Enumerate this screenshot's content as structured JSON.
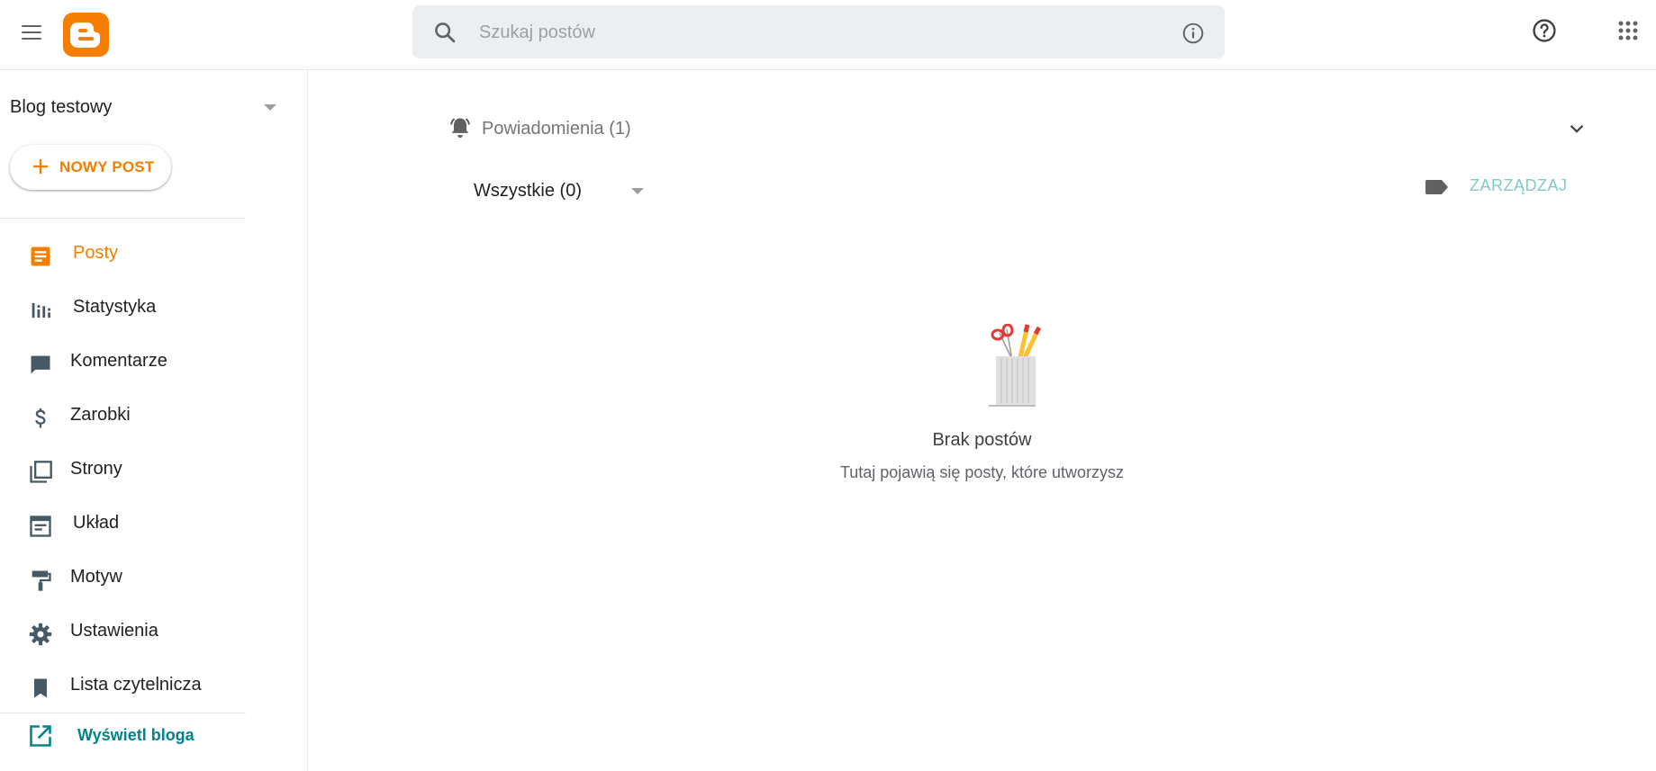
{
  "header": {
    "search_placeholder": "Szukaj postów",
    "icons": [
      "menu-icon",
      "blogger-logo",
      "search-icon",
      "info-icon",
      "help-icon",
      "apps-grid-icon"
    ],
    "brand_color": "#f57d00"
  },
  "sidebar": {
    "blog_name": "Blog testowy",
    "new_post_label": "NOWY POST",
    "items": [
      {
        "label": "Posty",
        "icon": "posts-icon",
        "active": true
      },
      {
        "label": "Statystyka",
        "icon": "stats-icon",
        "active": false
      },
      {
        "label": "Komentarze",
        "icon": "comments-icon",
        "active": false
      },
      {
        "label": "Zarobki",
        "icon": "dollar-icon",
        "active": false
      },
      {
        "label": "Strony",
        "icon": "pages-icon",
        "active": false
      },
      {
        "label": "Układ",
        "icon": "layout-icon",
        "active": false
      },
      {
        "label": "Motyw",
        "icon": "paint-roller-icon",
        "active": false
      },
      {
        "label": "Ustawienia",
        "icon": "gear-icon",
        "active": false
      },
      {
        "label": "Lista czytelnicza",
        "icon": "bookmark-icon",
        "active": false
      }
    ],
    "view_blog_label": "Wyświetl bloga",
    "accent_color": "#00838f"
  },
  "main": {
    "notifications_label": "Powiadomienia (1)",
    "filter_label": "Wszystkie (0)",
    "manage_label": "ZARZĄDZAJ",
    "empty_title": "Brak postów",
    "empty_subtitle": "Tutaj pojawią się posty, które utworzysz"
  }
}
